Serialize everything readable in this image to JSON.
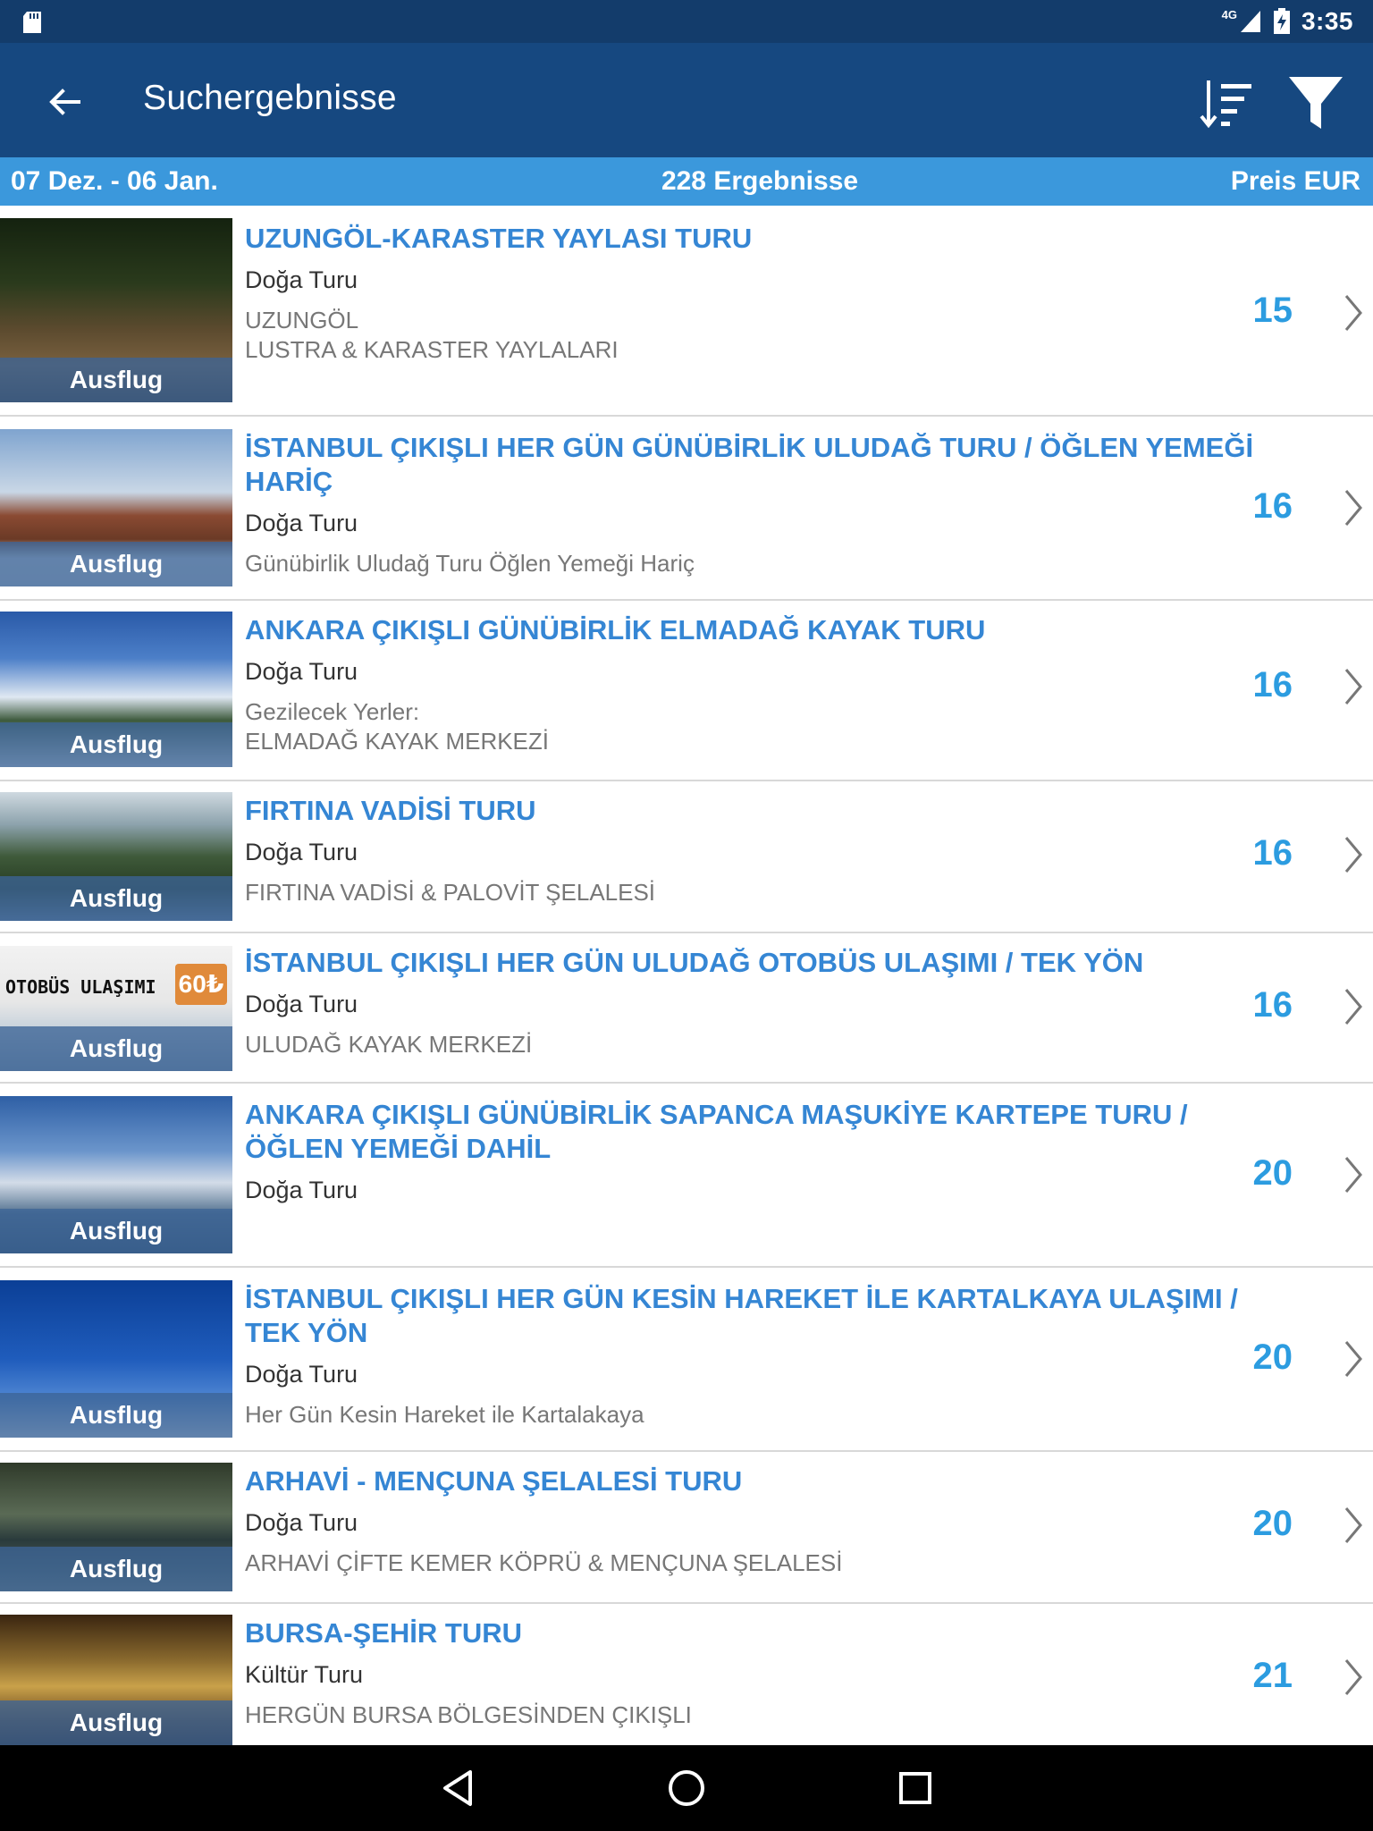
{
  "status_bar": {
    "network": "4G",
    "time": "3:35"
  },
  "app_bar": {
    "title": "Suchergebnisse"
  },
  "info_bar": {
    "dates": "07 Dez. - 06 Jan.",
    "count": "228 Ergebnisse",
    "currency": "Preis EUR"
  },
  "results": [
    {
      "title": "UZUNGÖL-KARASTER YAYLASI TURU",
      "category": "Doğa Turu",
      "description": "UZUNGÖL\nLUSTRA & KARASTER YAYLALARI",
      "price": "15",
      "badge": "Ausflug"
    },
    {
      "title": "İSTANBUL ÇIKIŞLI HER GÜN GÜNÜBİRLİK ULUDAĞ TURU / ÖĞLEN YEMEĞİ HARİÇ",
      "category": "Doğa Turu",
      "description": "Günübirlik Uludağ Turu Öğlen Yemeği Hariç",
      "price": "16",
      "badge": "Ausflug"
    },
    {
      "title": "ANKARA ÇIKIŞLI GÜNÜBİRLİK ELMADAĞ KAYAK TURU",
      "category": "Doğa Turu",
      "description": "Gezilecek Yerler:\nELMADAĞ KAYAK MERKEZİ",
      "price": "16",
      "badge": "Ausflug"
    },
    {
      "title": "FIRTINA VADİSİ TURU",
      "category": "Doğa Turu",
      "description": "FIRTINA VADİSİ & PALOVİT ŞELALESİ",
      "price": "16",
      "badge": "Ausflug"
    },
    {
      "title": "İSTANBUL ÇIKIŞLI HER GÜN ULUDAĞ OTOBÜS ULAŞIMI / TEK YÖN",
      "category": "Doğa Turu",
      "description": "ULUDAĞ KAYAK MERKEZİ",
      "price": "16",
      "badge": "Ausflug",
      "image_text": "OTOBÜS ULAŞIMI",
      "image_badge": "60₺"
    },
    {
      "title": "ANKARA ÇIKIŞLI GÜNÜBİRLİK SAPANCA MAŞUKİYE KARTEPE TURU / ÖĞLEN YEMEĞİ DAHİL",
      "category": "Doğa Turu",
      "description": "",
      "price": "20",
      "badge": "Ausflug"
    },
    {
      "title": "İSTANBUL ÇIKIŞLI HER GÜN KESİN HAREKET İLE KARTALKAYA ULAŞIMI / TEK YÖN",
      "category": "Doğa Turu",
      "description": "Her Gün Kesin Hareket ile Kartalakaya",
      "price": "20",
      "badge": "Ausflug"
    },
    {
      "title": "ARHAVİ - MENÇUNA ŞELALESİ TURU",
      "category": "Doğa Turu",
      "description": "ARHAVİ ÇİFTE KEMER KÖPRÜ & MENÇUNA ŞELALESİ",
      "price": "20",
      "badge": "Ausflug"
    },
    {
      "title": "BURSA-ŞEHİR TURU",
      "category": "Kültür Turu",
      "description": "HERGÜN BURSA BÖLGESİNDEN ÇIKIŞLI",
      "price": "21",
      "badge": "Ausflug"
    }
  ]
}
